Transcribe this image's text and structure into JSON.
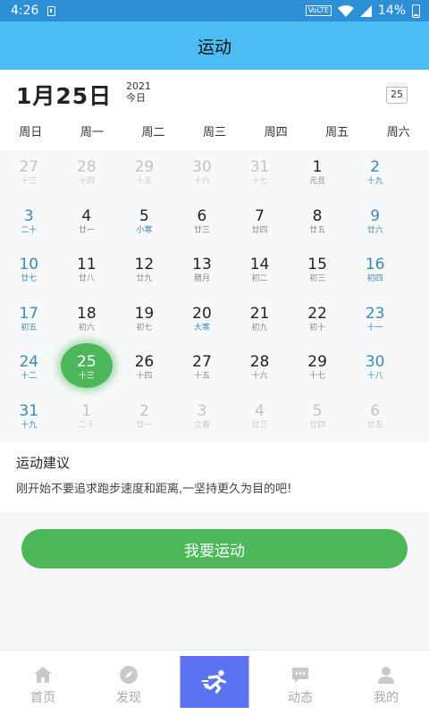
{
  "status": {
    "time": "4:26",
    "network": "VoLTE",
    "battery": "14%"
  },
  "header": {
    "title": "运动"
  },
  "date": {
    "big": "1月25日",
    "year": "2021",
    "today": "今日",
    "icon_day": "25"
  },
  "week": [
    "周日",
    "周一",
    "周二",
    "周三",
    "周四",
    "周五",
    "周六"
  ],
  "days": [
    {
      "num": "27",
      "lunar": "十三",
      "type": "other"
    },
    {
      "num": "28",
      "lunar": "十四",
      "type": "other"
    },
    {
      "num": "29",
      "lunar": "十五",
      "type": "other"
    },
    {
      "num": "30",
      "lunar": "十六",
      "type": "other"
    },
    {
      "num": "31",
      "lunar": "十七",
      "type": "other"
    },
    {
      "num": "1",
      "lunar": "元旦",
      "type": "normal"
    },
    {
      "num": "2",
      "lunar": "十九",
      "type": "weekend"
    },
    {
      "num": "3",
      "lunar": "二十",
      "type": "weekend"
    },
    {
      "num": "4",
      "lunar": "廿一",
      "type": "normal"
    },
    {
      "num": "5",
      "lunar": "小寒",
      "type": "festival"
    },
    {
      "num": "6",
      "lunar": "廿三",
      "type": "normal"
    },
    {
      "num": "7",
      "lunar": "廿四",
      "type": "normal"
    },
    {
      "num": "8",
      "lunar": "廿五",
      "type": "normal"
    },
    {
      "num": "9",
      "lunar": "廿六",
      "type": "weekend"
    },
    {
      "num": "10",
      "lunar": "廿七",
      "type": "weekend"
    },
    {
      "num": "11",
      "lunar": "廿八",
      "type": "normal"
    },
    {
      "num": "12",
      "lunar": "廿九",
      "type": "normal"
    },
    {
      "num": "13",
      "lunar": "腊月",
      "type": "normal"
    },
    {
      "num": "14",
      "lunar": "初二",
      "type": "normal"
    },
    {
      "num": "15",
      "lunar": "初三",
      "type": "normal"
    },
    {
      "num": "16",
      "lunar": "初四",
      "type": "weekend"
    },
    {
      "num": "17",
      "lunar": "初五",
      "type": "weekend"
    },
    {
      "num": "18",
      "lunar": "初六",
      "type": "normal"
    },
    {
      "num": "19",
      "lunar": "初七",
      "type": "normal"
    },
    {
      "num": "20",
      "lunar": "大寒",
      "type": "festival"
    },
    {
      "num": "21",
      "lunar": "初九",
      "type": "normal"
    },
    {
      "num": "22",
      "lunar": "初十",
      "type": "normal"
    },
    {
      "num": "23",
      "lunar": "十一",
      "type": "weekend"
    },
    {
      "num": "24",
      "lunar": "十二",
      "type": "weekend"
    },
    {
      "num": "25",
      "lunar": "十三",
      "type": "selected"
    },
    {
      "num": "26",
      "lunar": "十四",
      "type": "normal"
    },
    {
      "num": "27",
      "lunar": "十五",
      "type": "normal"
    },
    {
      "num": "28",
      "lunar": "十六",
      "type": "normal"
    },
    {
      "num": "29",
      "lunar": "十七",
      "type": "normal"
    },
    {
      "num": "30",
      "lunar": "十八",
      "type": "weekend"
    },
    {
      "num": "31",
      "lunar": "十九",
      "type": "weekend"
    },
    {
      "num": "1",
      "lunar": "二十",
      "type": "other"
    },
    {
      "num": "2",
      "lunar": "廿一",
      "type": "other"
    },
    {
      "num": "3",
      "lunar": "立春",
      "type": "other"
    },
    {
      "num": "4",
      "lunar": "廿三",
      "type": "other"
    },
    {
      "num": "5",
      "lunar": "廿四",
      "type": "other"
    },
    {
      "num": "6",
      "lunar": "廿五",
      "type": "other"
    }
  ],
  "advice": {
    "title": "运动建议",
    "text": "刚开始不要追求跑步速度和距离,一坚持更久为目的吧!"
  },
  "action": {
    "label": "我要运动"
  },
  "tabs": [
    {
      "label": "首页",
      "icon": "home-icon"
    },
    {
      "label": "发现",
      "icon": "compass-icon"
    },
    {
      "label": "",
      "icon": "runner-icon"
    },
    {
      "label": "动态",
      "icon": "chat-icon"
    },
    {
      "label": "我的",
      "icon": "user-icon"
    }
  ],
  "colors": {
    "header": "#4cbcf5",
    "statusbar": "#2d8fd5",
    "accent": "#4cb85a",
    "weekend": "#3d88b8",
    "tab_center": "#5b73f0"
  }
}
